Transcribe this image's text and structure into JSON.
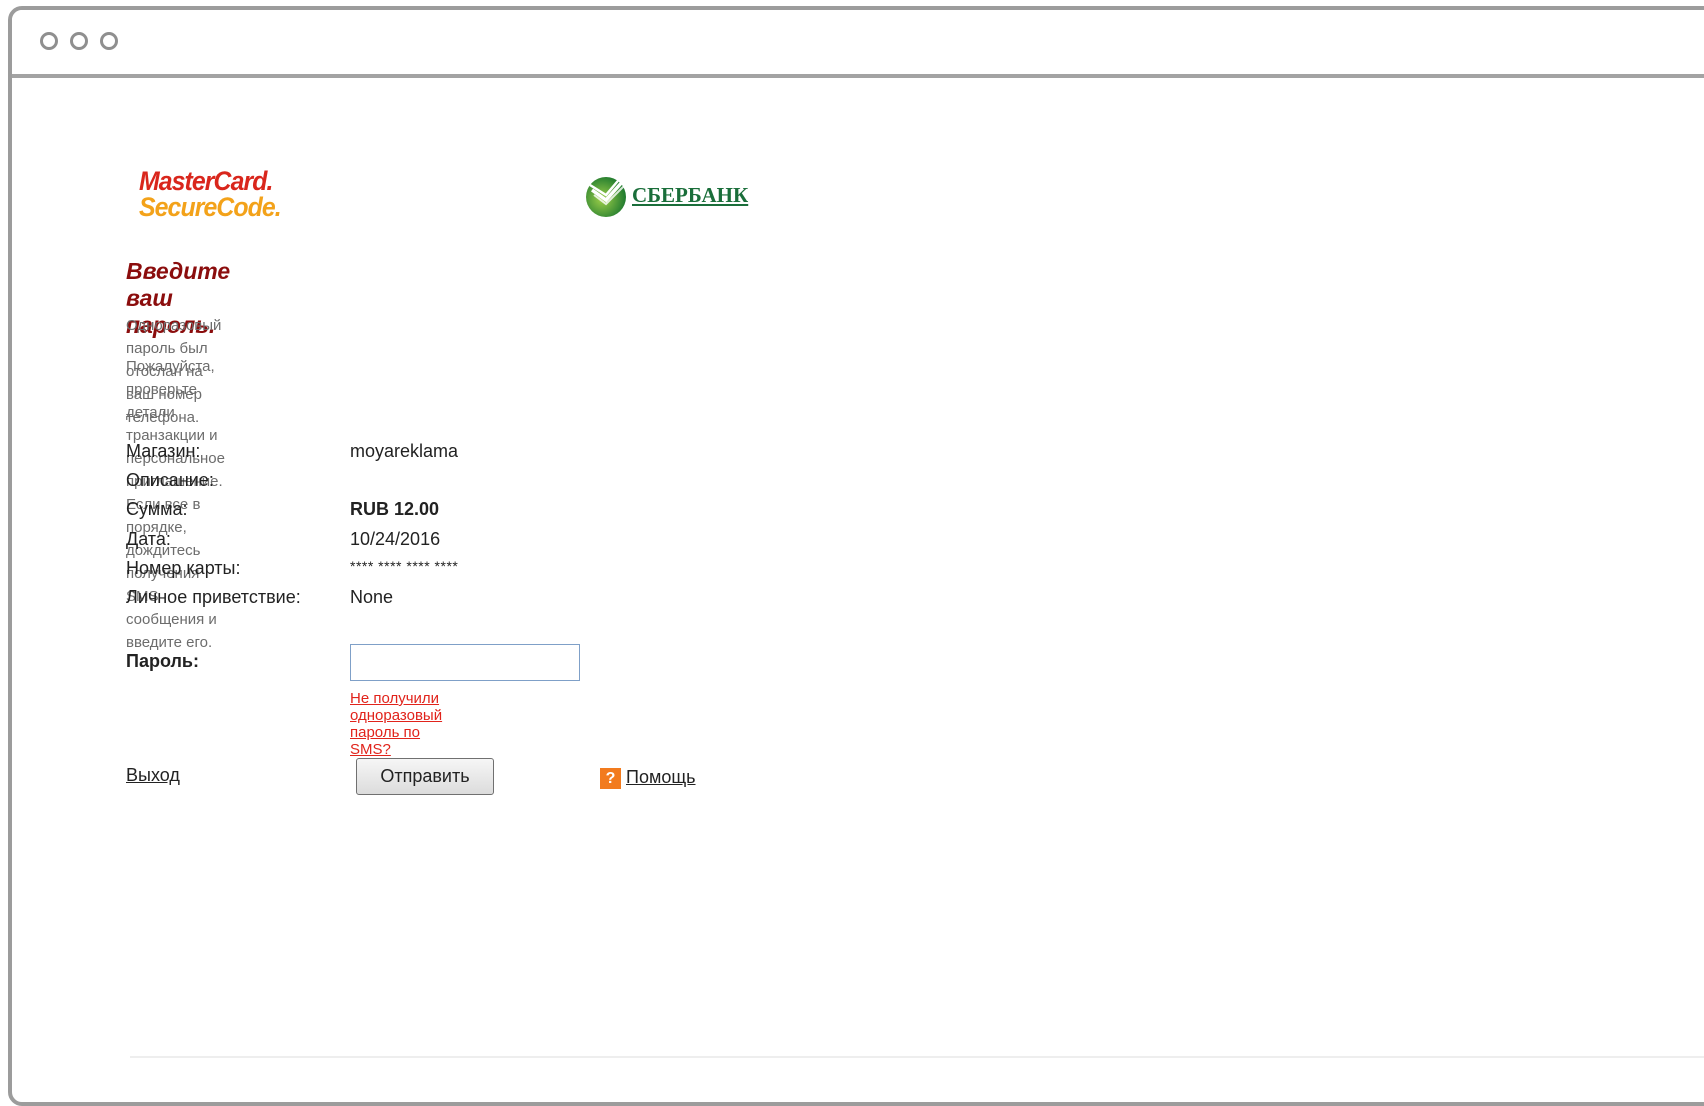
{
  "logos": {
    "mastercard_line1": "MasterCard",
    "mastercard_line2": "SecureCode",
    "bank_name": "СБЕРБАНК"
  },
  "heading": "Введите ваш пароль.",
  "info": {
    "line1": "Одноразовый пароль был отослан на ваш номер телефона.",
    "line2": "Пожалуйста, проверьте детали транзакции и персональное приглашение.",
    "line3": "Если все в порядке, дождитесь получения SMS сообщения и введите его."
  },
  "details": [
    {
      "label": "Магазин:",
      "value": "moyareklama"
    },
    {
      "label": "Описание:",
      "value": ""
    },
    {
      "label": "Сумма:",
      "value": "RUB 12.00"
    },
    {
      "label": "Дата:",
      "value": "10/24/2016"
    },
    {
      "label": "Номер карты:",
      "value": "**** **** **** ****"
    },
    {
      "label": "Личное приветствие:",
      "value": "None"
    }
  ],
  "password": {
    "label": "Пароль:",
    "value": "",
    "sms_link": "Не получили одноразовый пароль по SMS?"
  },
  "actions": {
    "exit": "Выход",
    "submit": "Отправить",
    "help_icon": "?",
    "help": "Помощь"
  },
  "colors": {
    "heading": "#8b0d0d",
    "link_red": "#e1231b",
    "mastercard_red": "#d9261c",
    "mastercard_orange": "#f3a21a",
    "sber_green": "#1a6e3a",
    "help_orange": "#f27b1e"
  }
}
